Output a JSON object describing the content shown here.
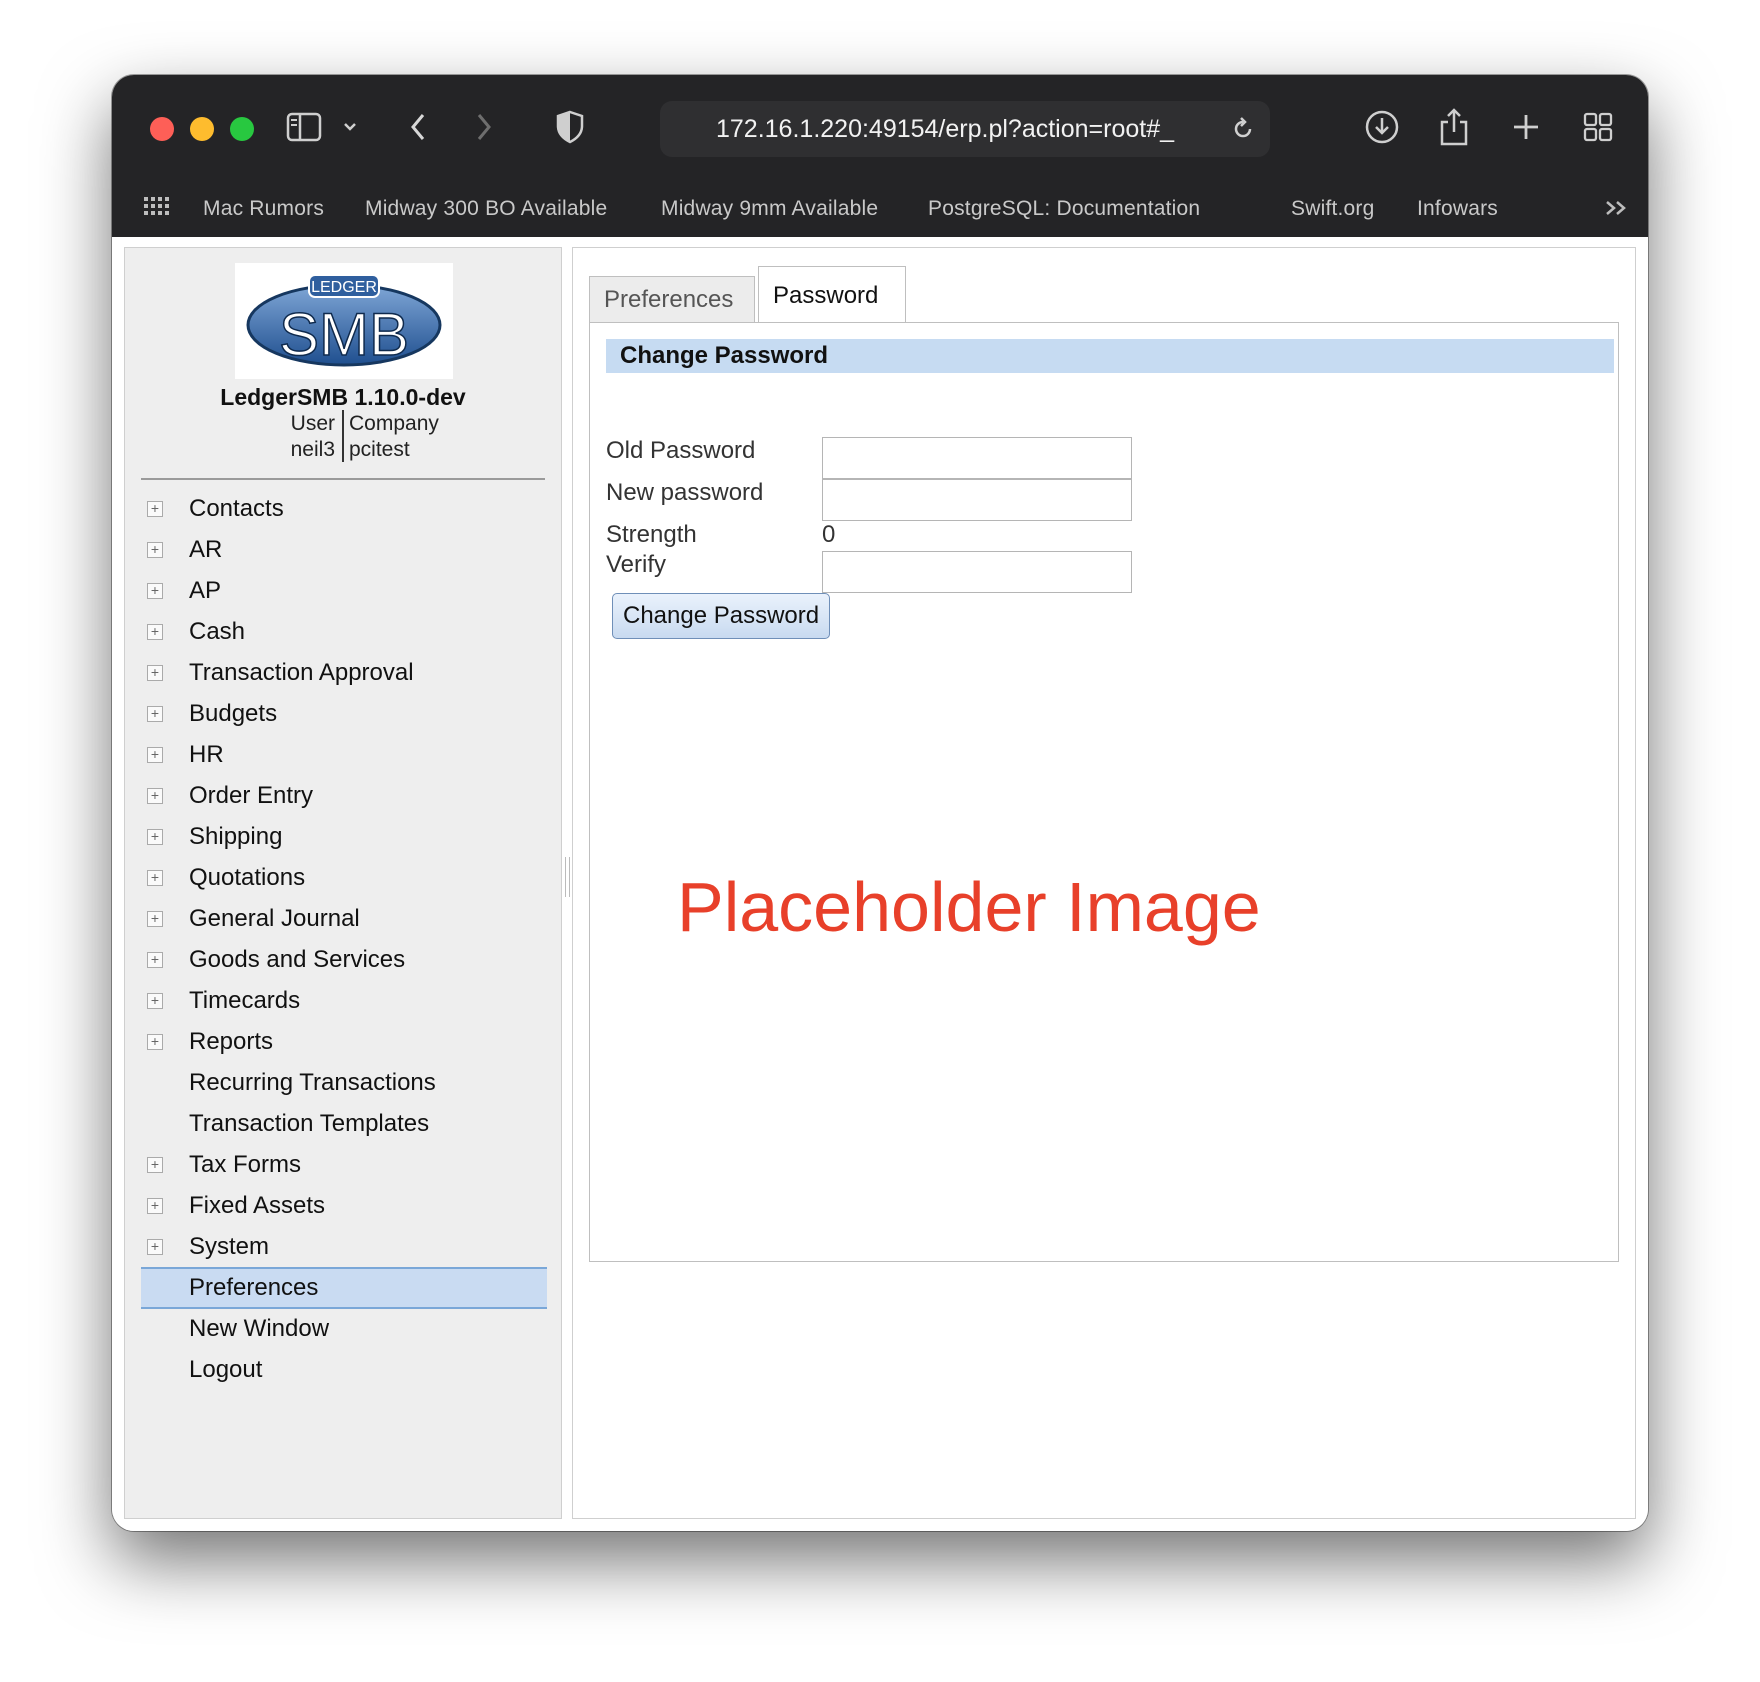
{
  "browser": {
    "url": "172.16.1.220:49154/erp.pl?action=root#_",
    "bookmarks": [
      "Mac Rumors",
      "Midway 300 BO Available",
      "Midway 9mm Available",
      "PostgreSQL: Documentation",
      "Swift.org",
      "Infowars"
    ],
    "icons": [
      "sidebar-icon",
      "chevron-down-icon",
      "back-icon",
      "forward-icon",
      "shield-icon",
      "reload-icon",
      "download-icon",
      "share-icon",
      "new-tab-icon",
      "tab-overview-icon",
      "grid-icon",
      "more-bookmarks-icon"
    ]
  },
  "app": {
    "logo_text_top": "LEDGER",
    "logo_text_main": "SMB",
    "title": "LedgerSMB 1.10.0-dev",
    "user_label": "User",
    "company_label": "Company",
    "user_value": "neil3",
    "company_value": "pcitest"
  },
  "menu": {
    "items": [
      {
        "label": "Contacts",
        "expandable": true
      },
      {
        "label": "AR",
        "expandable": true
      },
      {
        "label": "AP",
        "expandable": true
      },
      {
        "label": "Cash",
        "expandable": true
      },
      {
        "label": "Transaction Approval",
        "expandable": true
      },
      {
        "label": "Budgets",
        "expandable": true
      },
      {
        "label": "HR",
        "expandable": true
      },
      {
        "label": "Order Entry",
        "expandable": true
      },
      {
        "label": "Shipping",
        "expandable": true
      },
      {
        "label": "Quotations",
        "expandable": true
      },
      {
        "label": "General Journal",
        "expandable": true
      },
      {
        "label": "Goods and Services",
        "expandable": true
      },
      {
        "label": "Timecards",
        "expandable": true
      },
      {
        "label": "Reports",
        "expandable": true
      },
      {
        "label": "Recurring Transactions",
        "expandable": false
      },
      {
        "label": "Transaction Templates",
        "expandable": false
      },
      {
        "label": "Tax Forms",
        "expandable": true
      },
      {
        "label": "Fixed Assets",
        "expandable": true
      },
      {
        "label": "System",
        "expandable": true
      },
      {
        "label": "Preferences",
        "expandable": false,
        "active": true
      },
      {
        "label": "New Window",
        "expandable": false
      },
      {
        "label": "Logout",
        "expandable": false
      }
    ]
  },
  "tabs": {
    "preferences": "Preferences",
    "password": "Password"
  },
  "form": {
    "section_title": "Change Password",
    "old_password_label": "Old Password",
    "new_password_label": "New password",
    "strength_label": "Strength",
    "strength_value": "0",
    "verify_label": "Verify",
    "old_password_value": "",
    "new_password_value": "",
    "verify_value": "",
    "submit_label": "Change Password"
  },
  "overlay": {
    "placeholder_text": "Placeholder Image"
  },
  "colors": {
    "accent_header": "#c6dbf2",
    "active_menu": "#c9dbf2",
    "placeholder": "#e8402a"
  }
}
